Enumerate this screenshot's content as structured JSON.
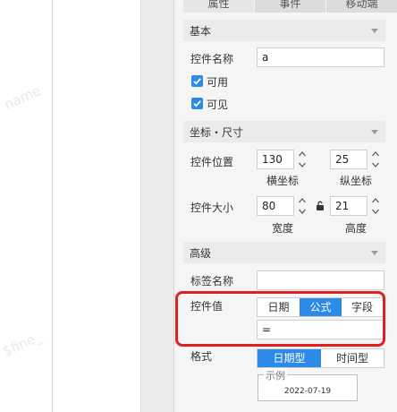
{
  "tabs": [
    {
      "label": "属性",
      "active": true
    },
    {
      "label": "事件",
      "active": false
    },
    {
      "label": "移动端",
      "active": false
    }
  ],
  "sections": {
    "basic": "基本",
    "coords": "坐标・尺寸",
    "advanced": "高级"
  },
  "basic": {
    "name_label": "控件名称",
    "name_value": "a",
    "enabled_label": "可用",
    "enabled_checked": true,
    "visible_label": "可见",
    "visible_checked": true
  },
  "coords": {
    "position_label": "控件位置",
    "x_value": "130",
    "y_value": "25",
    "x_label": "横坐标",
    "y_label": "纵坐标",
    "size_label": "控件大小",
    "width_value": "80",
    "height_value": "21",
    "width_label": "宽度",
    "height_label": "高度"
  },
  "advanced": {
    "tag_label": "标签名称",
    "tag_value": "",
    "value_label": "控件值",
    "value_options": [
      "日期",
      "公式",
      "字段"
    ],
    "value_selected": "公式",
    "formula_value": "=",
    "format_label": "格式",
    "format_options": [
      "日期型",
      "时间型"
    ],
    "format_selected": "日期型",
    "example_legend": "示例",
    "example_value": "2022-07-19"
  },
  "watermark": {
    "text1": "name",
    "text2": "$fine_"
  },
  "colors": {
    "accent": "#2d8ae6",
    "highlight": "#e02020"
  }
}
